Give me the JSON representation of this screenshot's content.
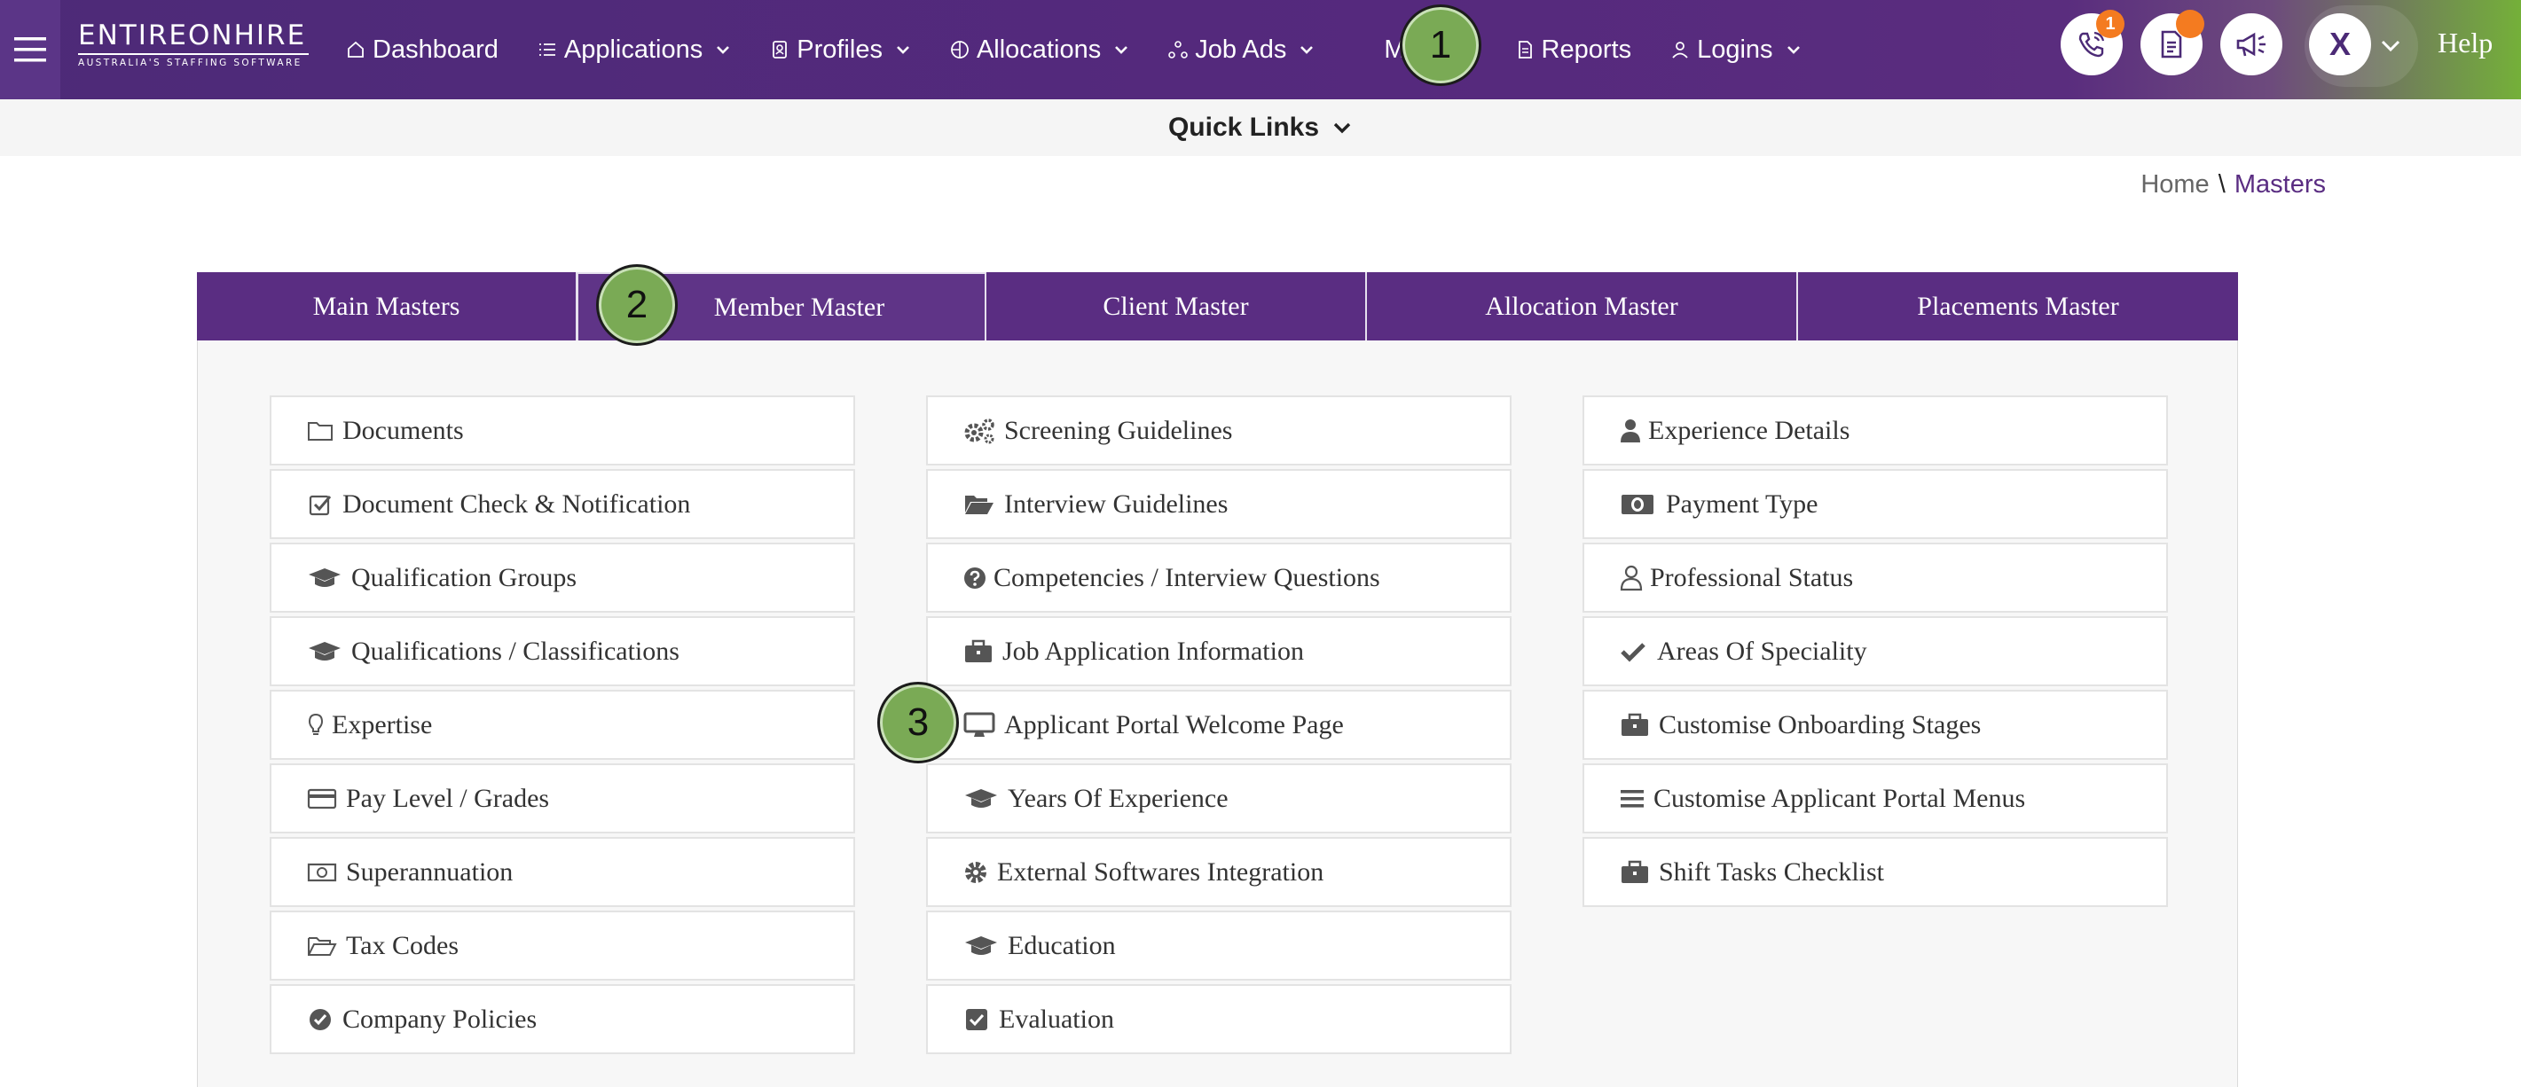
{
  "navbar": {
    "logo_title": "ENTIREONHIRE",
    "logo_subtitle": "AUSTRALIA'S STAFFING SOFTWARE",
    "items": [
      {
        "label": "Dashboard"
      },
      {
        "label": "Applications"
      },
      {
        "label": "Profiles"
      },
      {
        "label": "Allocations"
      },
      {
        "label": "Job Ads"
      },
      {
        "label": "Masters"
      },
      {
        "label": "Reports"
      },
      {
        "label": "Logins"
      }
    ],
    "phone_badge": "1",
    "avatar_initial": "X",
    "help_label": "Help"
  },
  "quick_links": {
    "label": "Quick Links"
  },
  "breadcrumb": {
    "home": "Home",
    "separator": "\\",
    "current": "Masters"
  },
  "tabs": [
    {
      "label": "Main Masters"
    },
    {
      "label": "Member Master"
    },
    {
      "label": "Client Master"
    },
    {
      "label": "Allocation Master"
    },
    {
      "label": "Placements Master"
    }
  ],
  "columns": [
    {
      "items": [
        {
          "label": "Documents",
          "icon": "folder-icon"
        },
        {
          "label": "Document Check & Notification",
          "icon": "checkbox-icon"
        },
        {
          "label": "Qualification Groups",
          "icon": "graduation-cap-icon"
        },
        {
          "label": "Qualifications / Classifications",
          "icon": "graduation-cap-icon"
        },
        {
          "label": "Expertise",
          "icon": "lightbulb-icon"
        },
        {
          "label": "Pay Level / Grades",
          "icon": "credit-card-icon"
        },
        {
          "label": "Superannuation",
          "icon": "money-icon"
        },
        {
          "label": "Tax Codes",
          "icon": "folder-open-icon"
        },
        {
          "label": "Company Policies",
          "icon": "check-circle-icon"
        }
      ]
    },
    {
      "items": [
        {
          "label": "Screening Guidelines",
          "icon": "gears-icon"
        },
        {
          "label": "Interview Guidelines",
          "icon": "folder-open-solid-icon"
        },
        {
          "label": "Competencies / Interview Questions",
          "icon": "question-circle-icon"
        },
        {
          "label": "Job Application Information",
          "icon": "briefcase-icon"
        },
        {
          "label": "Applicant Portal Welcome Page",
          "icon": "desktop-icon"
        },
        {
          "label": "Years Of Experience",
          "icon": "graduation-cap-icon"
        },
        {
          "label": "External Softwares Integration",
          "icon": "gear-icon"
        },
        {
          "label": "Education",
          "icon": "graduation-cap-icon"
        },
        {
          "label": "Evaluation",
          "icon": "check-square-icon"
        }
      ]
    },
    {
      "items": [
        {
          "label": "Experience Details",
          "icon": "user-icon"
        },
        {
          "label": "Payment Type",
          "icon": "money-icon"
        },
        {
          "label": "Professional Status",
          "icon": "user-outline-icon"
        },
        {
          "label": "Areas Of Speciality",
          "icon": "check-icon"
        },
        {
          "label": "Customise Onboarding Stages",
          "icon": "briefcase-icon"
        },
        {
          "label": "Customise Applicant Portal Menus",
          "icon": "bars-icon"
        },
        {
          "label": "Shift Tasks Checklist",
          "icon": "briefcase-icon"
        }
      ]
    }
  ],
  "markers": [
    {
      "label": "1"
    },
    {
      "label": "2"
    },
    {
      "label": "3"
    }
  ],
  "colors": {
    "nav_purple": "#55297d",
    "tab_purple": "#5a2d82",
    "accent_orange": "#f47b20",
    "marker_green": "#7aaa55"
  }
}
